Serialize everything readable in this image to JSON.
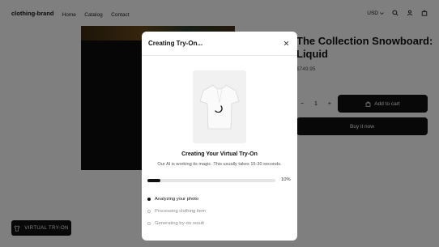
{
  "header": {
    "brand": "clothing-brand",
    "nav": [
      "Home",
      "Catalog",
      "Contact"
    ],
    "currency": "USD"
  },
  "product": {
    "title": "The Collection Snowboard: Liquid",
    "price": "$749.95",
    "quantity": "1",
    "qty_minus": "−",
    "qty_plus": "+",
    "add_to_cart": "Add to cart",
    "buy_now": "Buy it now"
  },
  "virtual_tryon_button": "VIRTUAL TRY-ON",
  "modal": {
    "title": "Creating Try-On...",
    "heading": "Creating Your Virtual Try-On",
    "subtitle": "Our AI is working its magic. This usually takes 15-30 seconds.",
    "progress_percent": 10,
    "progress_label": "10%",
    "steps": [
      {
        "label": "Analyzing your photo",
        "state": "active"
      },
      {
        "label": "Processing clothing item",
        "state": "pending"
      },
      {
        "label": "Generating try-on result",
        "state": "pending"
      }
    ]
  },
  "colors": {
    "accent": "#111111",
    "overlay": "rgba(0,0,0,0.5)",
    "progress_track": "#e5e5e5"
  },
  "icons": [
    "search-icon",
    "account-icon",
    "cart-icon",
    "close-icon",
    "shirt-icon",
    "bag-icon",
    "chevron-down-icon"
  ]
}
